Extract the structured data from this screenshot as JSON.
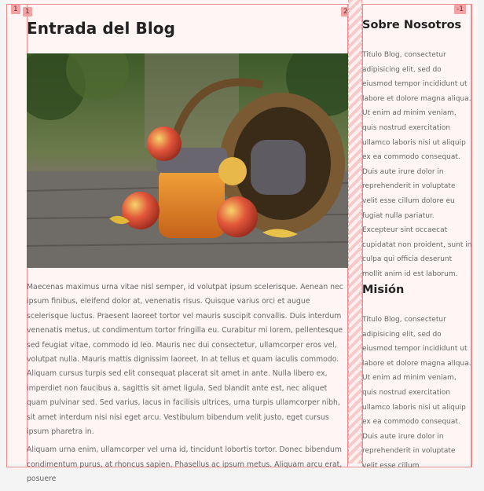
{
  "badges": {
    "one": "1",
    "two": "2",
    "minus_one": "-1",
    "page_one": "1"
  },
  "post": {
    "title": "Entrada del Blog",
    "paragraphs": [
      "Maecenas maximus urna vitae nisl semper, id volutpat ipsum scelerisque. Aenean nec ipsum finibus, eleifend dolor at, venenatis risus. Quisque varius orci et augue scelerisque luctus. Praesent laoreet tortor vel mauris suscipit convallis. Duis interdum venenatis metus, ut condimentum tortor fringilla eu. Curabitur mi lorem, pellentesque sed feugiat vitae, commodo id leo. Mauris nec dui consectetur, ullamcorper eros vel, volutpat nulla. Mauris mattis dignissim laoreet. In at tellus et quam iaculis commodo. Aliquam cursus turpis sed elit consequat placerat sit amet in ante. Nulla libero ex, imperdiet non faucibus a, sagittis sit amet ligula. Sed blandit ante est, nec aliquet quam pulvinar sed. Sed varius, lacus in facilisis ultrices, urna turpis ullamcorper nibh, sit amet interdum nisi nisi eget arcu. Vestibulum bibendum velit justo, eget cursus ipsum pharetra in.",
      "Aliquam urna enim, ullamcorper vel urna id, tincidunt lobortis tortor. Donec bibendum condimentum purus, at rhoncus sapien. Phasellus ac ipsum metus. Aliquam arcu erat, posuere"
    ]
  },
  "sidebar": {
    "about_title": "Sobre Nosotros",
    "about_text": "Titulo Blog, consectetur adipisicing elit, sed do eiusmod tempor incididunt ut labore et dolore magna aliqua. Ut enim ad minim veniam, quis nostrud exercitation ullamco laboris nisi ut aliquip ex ea commodo consequat. Duis aute irure dolor in reprehenderit in voluptate velit esse cillum dolore eu fugiat nulla pariatur. Excepteur sint occaecat cupidatat non proident, sunt in culpa qui officia deserunt mollit anim id est laborum.",
    "mission_title": "Misión",
    "mission_text": "Titulo Blog, consectetur adipisicing elit, sed do eiusmod tempor incididunt ut labore et dolore magna aliqua. Ut enim ad minim veniam, quis nostrud exercitation ullamco laboris nisi ut aliquip ex ea commodo consequat. Duis aute irure dolor in reprehenderit in voluptate velit esse cillum"
  },
  "colors": {
    "outline": "#f08c8c",
    "badge": "#f3a3a3",
    "canvas": "#fff5f5"
  }
}
